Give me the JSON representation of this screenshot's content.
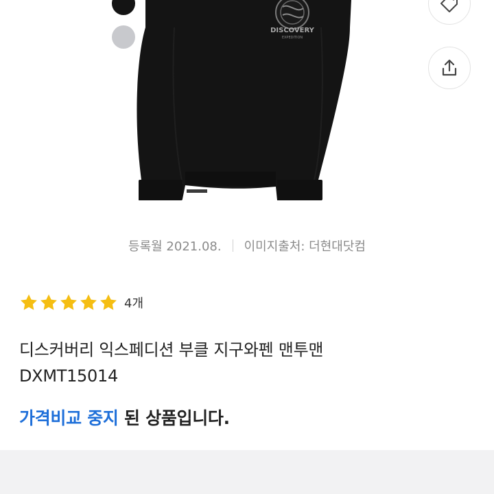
{
  "product": {
    "color_options": [
      {
        "name": "black",
        "color": "#141414"
      },
      {
        "name": "gray",
        "color": "#c8c9cd"
      }
    ],
    "image_print": {
      "brand": "DISCOVERY",
      "sub": "EXPEDITION"
    },
    "meta": {
      "registered": "등록월 2021.08.",
      "image_source": "이미지출처: 더현대닷컴"
    },
    "rating": {
      "stars": 5,
      "star_color": "#f5be12",
      "review_count": "4개"
    },
    "title_line1": "디스커버리 익스페디션 부클 지구와펜 맨투맨",
    "title_line2": "DXMT15014",
    "notice": {
      "accent": "가격비교 중지",
      "rest": " 된 상품입니다.",
      "accent_color": "#1e6fd9"
    }
  },
  "actions": {
    "wishlist_icon": "tag-heart-icon",
    "share_icon": "share-icon"
  }
}
